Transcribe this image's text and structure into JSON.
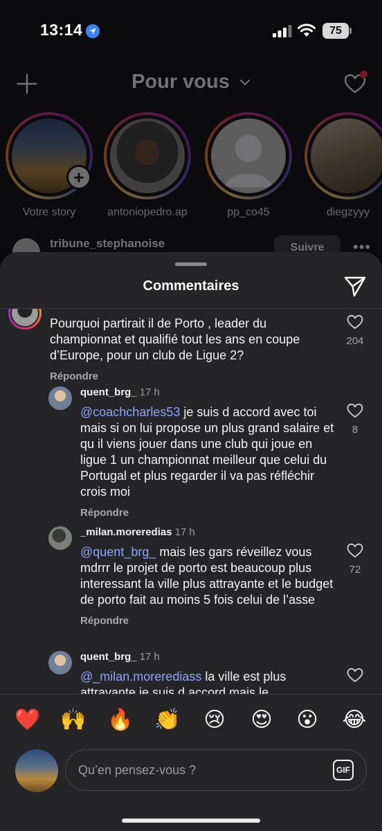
{
  "status_bar": {
    "time": "13:14",
    "battery": "75"
  },
  "feed": {
    "title": "Pour vous",
    "stories": [
      {
        "name": "Votre story"
      },
      {
        "name": "antoniopedro.ap"
      },
      {
        "name": "pp_co45"
      },
      {
        "name": "diegzyyy"
      }
    ],
    "post": {
      "username": "tribune_stephanoise",
      "follow_label": "Suivre"
    }
  },
  "sheet": {
    "title": "Commentaires",
    "comments": [
      {
        "text": "Pourquoi partirait il de Porto , leader du championnat et qualifié tout les ans en coupe d’Europe, pour un club de Ligue 2?",
        "likes": "204",
        "reply_label": "Répondre"
      },
      {
        "username": "quent_brg_",
        "time": "17 h",
        "mention": "@coachcharles53",
        "text": " je suis d accord avec toi mais si on lui propose un plus grand salaire et qu il viens jouer dans une club qui joue en ligue 1 un championnat meilleur que celui du Portugal et plus regarder il va pas réfléchir crois moi",
        "likes": "8",
        "reply_label": "Répondre"
      },
      {
        "username": "_milan.moreredias",
        "time": "17 h",
        "mention": "@quent_brg_",
        "text": " mais les gars réveillez vous mdrrr le projet de porto est beaucoup plus interessant la ville plus attrayante et le budget de porto fait au moins 5 fois celui de l’asse",
        "likes": "72",
        "reply_label": "Répondre"
      },
      {
        "username": "quent_brg_",
        "time": "17 h",
        "mention": "@_milan.morerediass",
        "text": " la ville est plus attravante je suis d accord mais le"
      }
    ],
    "emojis": [
      "❤️",
      "🙌",
      "🔥",
      "👏",
      "😢",
      "😍",
      "😮",
      "😂"
    ],
    "input": {
      "placeholder": "Qu’en pensez-vous ?",
      "gif_label": "GIF"
    }
  },
  "colors": {
    "mention": "#8aa4ff",
    "sheet_bg": "#252527",
    "notification_dot": "#ff3040"
  },
  "icons": [
    "location-arrow-icon",
    "signal-icon",
    "wifi-icon",
    "plus-icon",
    "chevron-down-icon",
    "heart-icon",
    "share-send-icon",
    "like-heart-icon",
    "gif-icon"
  ]
}
